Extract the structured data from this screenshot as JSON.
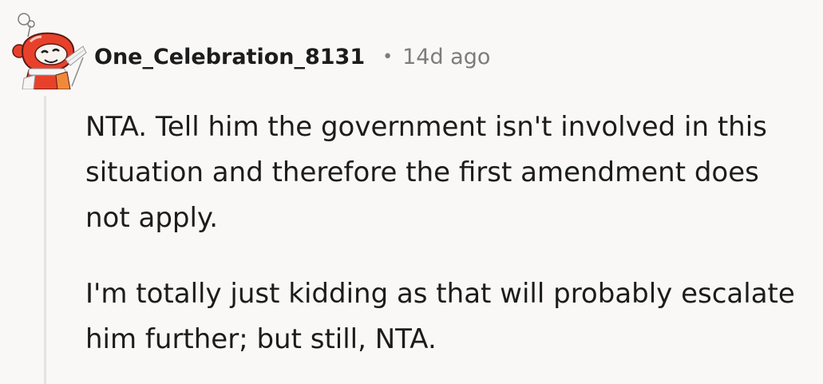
{
  "comment": {
    "author": "One_Celebration_8131",
    "separator": "•",
    "age": "14d ago",
    "avatar_icon": "snoo-avatar-icon",
    "paragraphs": [
      "NTA. Tell him the government isn't involved in this situation and therefore the first amendment does not apply.",
      "I'm totally just kidding as that will probably escalate him further; but still, NTA."
    ]
  },
  "colors": {
    "background": "#f9f8f7",
    "text": "#1c1c1c",
    "meta": "#7c7c7c",
    "thread_line": "#e5e3e0",
    "avatar_accent": "#e8412b"
  }
}
